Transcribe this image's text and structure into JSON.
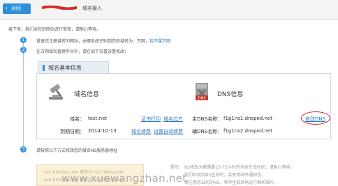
{
  "header": {
    "back_label": "返回",
    "breadcrumb": "域名接入"
  },
  "intro": "接下来，我们对您的网站进行审核，请耐心等待。",
  "steps": [
    {
      "num": "1",
      "text": "登录您注册域名的网站，由哪系统识别到您的域名为：万网，",
      "link": "我不属万网"
    },
    {
      "num": "2",
      "text": "在万网域名管理平台中，请在如下位置设置修改："
    },
    {
      "num": "3",
      "text": "请按照以下方式修改您的域名NS服务器地址"
    }
  ],
  "panel": {
    "tab_label": "域名基本信息",
    "domain_section": {
      "title": "域名信息",
      "domain_label": "域名：",
      "domain_value": "test.net",
      "expiry_label": "到期日期：",
      "expiry_value": "2014-10-13",
      "links": [
        "证书打印",
        "域名过户",
        "域名续费",
        "设置自动续费"
      ]
    },
    "dns_section": {
      "title": "DNS信息",
      "icon_text": "DNS",
      "primary_label": "主DNS名称：",
      "primary_value": "f1g1ns1.dnspod.net",
      "secondary_label": "辅DNS名称：",
      "secondary_value": "f1g1ns2.dnspod.net",
      "modify_link": "修改DNS"
    }
  },
  "bottom": {
    "box_line1": "ns1.hichina.com  修改为  ns1.hidns.com",
    "box_line2": "ns2.hichina.com  修改为  ns2.hidns.com",
    "hint_label": "提示：",
    "hint_line1": "NS修改大概需要12-72小时的全球生效时间，请耐心等待。",
    "hint_line2": "我们检测到NS生效时，会使用邮件通知您。",
    "hint_line3": "请注意您当前的NS，等待生效后再进行解析操作。"
  },
  "watermark": "www.xuewangzhan.net",
  "colors": {
    "accent": "#2d8fd8",
    "link": "#2b78c5",
    "highlight_circle": "#d42020",
    "tip_background": "#fbf0d9"
  }
}
